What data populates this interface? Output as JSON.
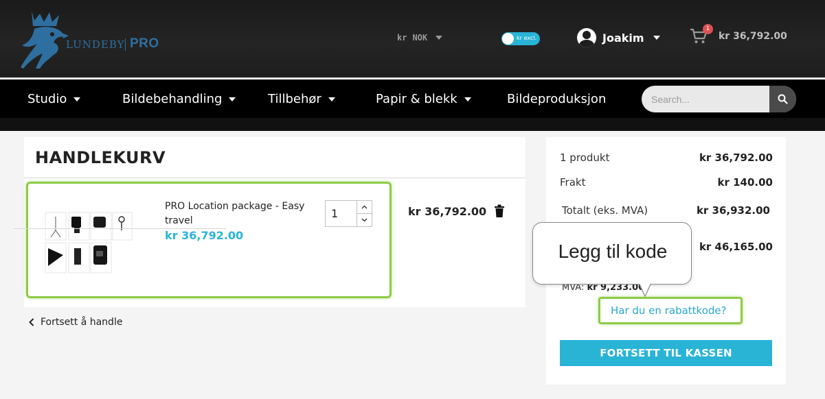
{
  "header": {
    "logo_text": "LUNDEBY",
    "logo_pro": "PRO",
    "currency_symbol": "kr",
    "currency_code": "NOK",
    "vat_toggle_label": "kr excl.",
    "user_name": "Joakim",
    "cart_count": "1",
    "cart_total": "kr 36,792.00"
  },
  "nav": {
    "items": [
      "Studio",
      "Bildebehandling",
      "Tillbehør",
      "Papir & blekk",
      "Bildeproduksjon"
    ],
    "search_placeholder": "Search..."
  },
  "cart": {
    "title": "HANDLEKURV",
    "product_name": "PRO Location package - Easy travel",
    "product_price": "kr 36,792.00",
    "quantity": "1",
    "line_total": "kr 36,792.00",
    "continue_label": "Fortsett å handle"
  },
  "summary": {
    "products_label": "1 produkt",
    "products_value": "kr 36,792.00",
    "shipping_label": "Frakt",
    "shipping_value": "kr 140.00",
    "total_ex_label": "Totalt (eks. MVA)",
    "total_ex_value": "kr 36,932.00",
    "total_value": "kr 46,165.00",
    "mva_label": "MVA:",
    "mva_value": "kr 9,233.00",
    "discount_link": "Har du en rabattkode?",
    "checkout_label": "FORTSETT TIL KASSEN"
  },
  "tooltip": {
    "text": "Legg til kode"
  },
  "colors": {
    "accent": "#29b4d6",
    "highlight": "#8ccc46",
    "header_bg": "#1e1e1e",
    "nav_bg": "#000000",
    "badge": "#e05050"
  }
}
